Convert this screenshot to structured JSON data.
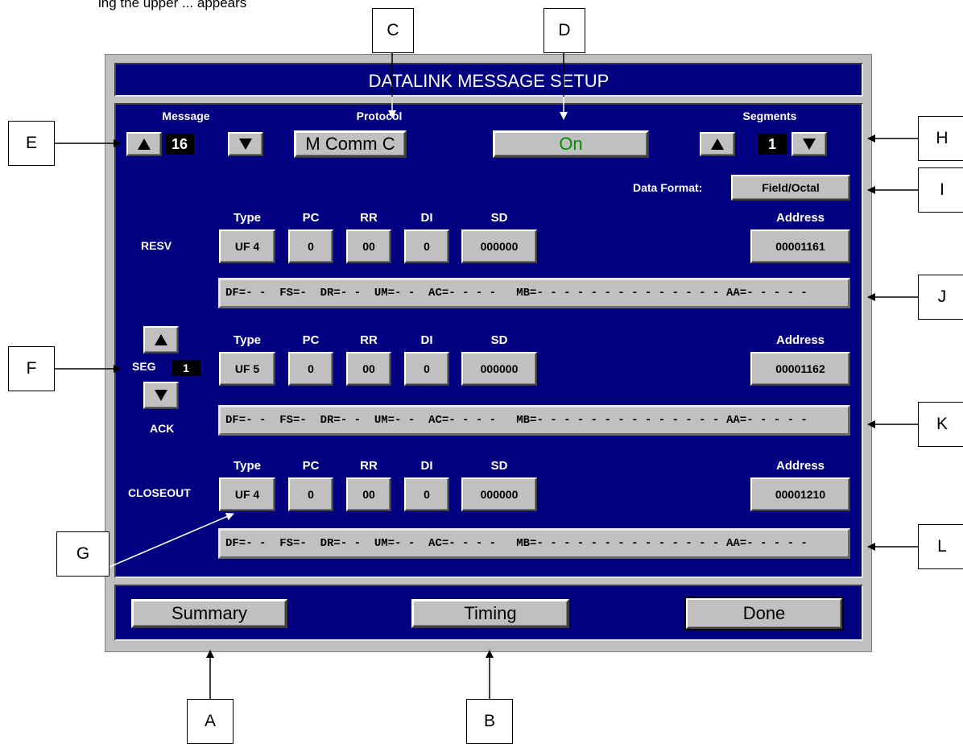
{
  "top_note": "ing the upper ... appears",
  "window": {
    "title": "DATALINK MESSAGE SETUP"
  },
  "header": {
    "message": {
      "label": "Message",
      "value": "16"
    },
    "protocol": {
      "label": "Protocol",
      "value": "M Comm C"
    },
    "status": {
      "value": "On",
      "color": "#009000"
    },
    "segments": {
      "label": "Segments",
      "value": "1"
    },
    "data_format": {
      "label": "Data Format:",
      "value": "Field/Octal"
    }
  },
  "field_headers": {
    "type": "Type",
    "pc": "PC",
    "rr": "RR",
    "di": "DI",
    "sd": "SD",
    "address": "Address"
  },
  "rows": [
    {
      "label": "RESV",
      "type": "UF 4",
      "pc": "0",
      "rr": "00",
      "di": "0",
      "sd": "000000",
      "address": "00001161"
    },
    {
      "label": "ACK",
      "type": "UF 5",
      "pc": "0",
      "rr": "00",
      "di": "0",
      "sd": "000000",
      "address": "00001162"
    },
    {
      "label": "CLOSEOUT",
      "type": "UF 4",
      "pc": "0",
      "rr": "00",
      "di": "0",
      "sd": "000000",
      "address": "00001210"
    }
  ],
  "decode_bars": [
    {
      "fields": "DF=- -  FS=-  DR=- -  UM=- -  AC=- - - -   MB=- - - - - - - - - - - - - -",
      "aa": "AA=- - - - -"
    },
    {
      "fields": "DF=- -  FS=-  DR=- -  UM=- -  AC=- - - -   MB=- - - - - - - - - - - - - -",
      "aa": "AA=- - - - -"
    },
    {
      "fields": "DF=- -  FS=-  DR=- -  UM=- -  AC=- - - -   MB=- - - - - - - - - - - - - -",
      "aa": "AA=- - - - -"
    }
  ],
  "segment_selector": {
    "label": "SEG",
    "value": "1"
  },
  "buttons": {
    "summary": "Summary",
    "timing": "Timing",
    "done": "Done"
  },
  "callouts": {
    "a": "A",
    "b": "B",
    "c": "C",
    "d": "D",
    "e": "E",
    "f": "F",
    "g": "G",
    "h": "H",
    "i": "I",
    "j": "J",
    "k": "K",
    "l": "L"
  },
  "colors": {
    "panel": "#000080",
    "bezel": "#c0c0c0",
    "status_text": "#009000"
  }
}
